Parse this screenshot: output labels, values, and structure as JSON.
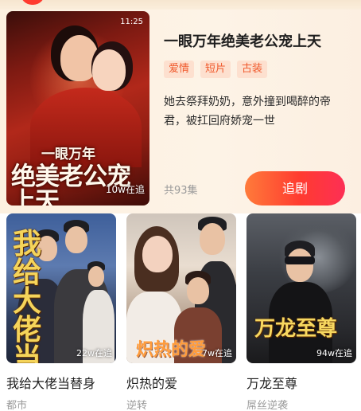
{
  "featured": {
    "title": "一眼万年绝美老公宠上天",
    "tags": [
      "爱情",
      "短片",
      "古装"
    ],
    "description": "她去祭拜奶奶，意外撞到喝醉的帝君，被扛回府娇宠一世",
    "episodes": "共93集",
    "follow_label": "追剧",
    "poster": {
      "time": "11:25",
      "views": "10w在追",
      "art_small": "一眼万年",
      "art_big": "绝美老公宠上天"
    }
  },
  "cards": [
    {
      "name": "我给大佬当替身",
      "genre": "都市",
      "views": "22w在追",
      "art": "我给大佬当替身"
    },
    {
      "name": "炽热的爱",
      "genre": "逆转",
      "views": "7w在追",
      "art": "炽热的爱"
    },
    {
      "name": "万龙至尊",
      "genre": "屌丝逆袭",
      "views": "94w在追",
      "art": "万龙至尊"
    }
  ],
  "colors": {
    "accent": "#ff3b30",
    "tag_text": "#f05a2d",
    "tag_bg": "#fde0cf",
    "featured_bg": "#fdf1e0"
  }
}
